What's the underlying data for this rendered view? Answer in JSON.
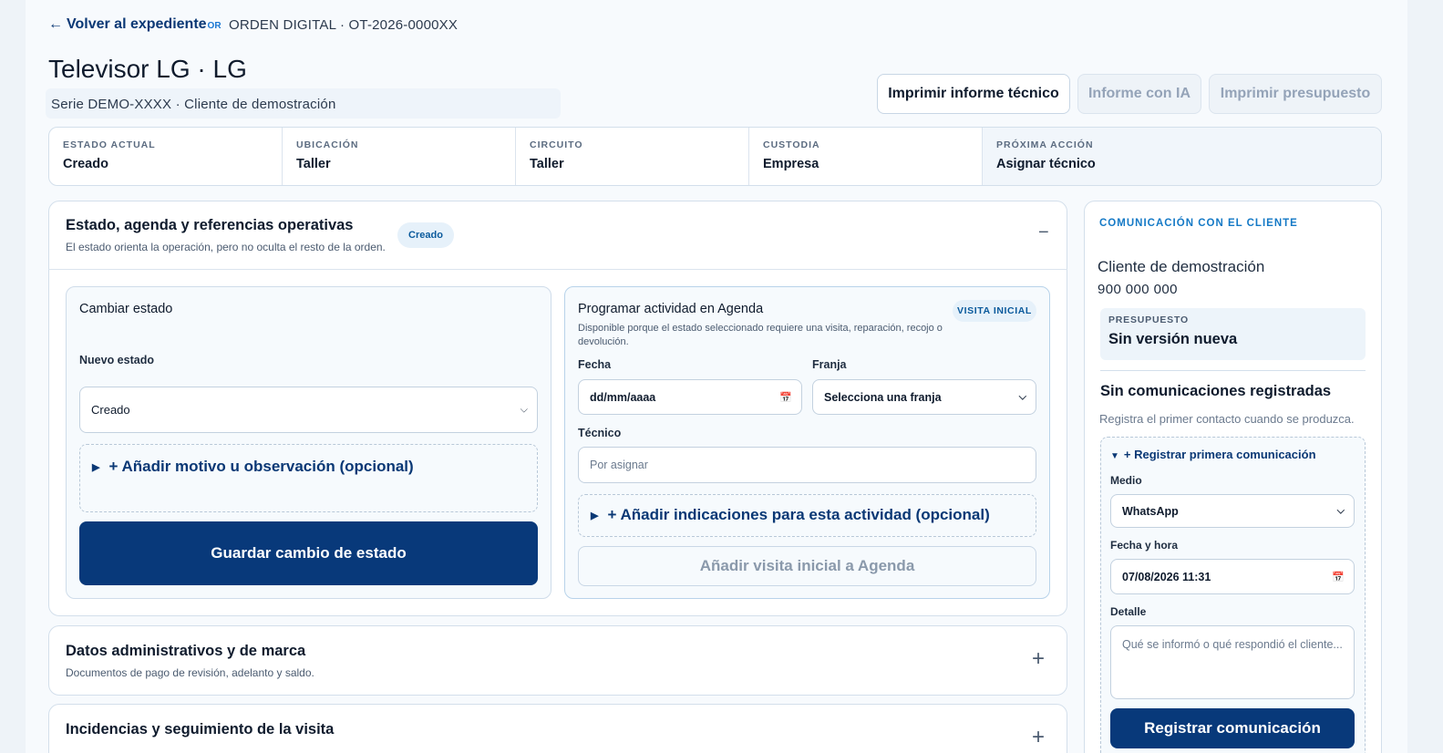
{
  "header": {
    "back_arrow": "←",
    "back_label": "Volver al expediente",
    "back_badge": "OR",
    "order_code": "ORDEN DIGITAL · OT-2026-0000XX",
    "title": "Televisor LG · LG",
    "subtitle": "Serie DEMO-XXXX · Cliente de demostración"
  },
  "actions": {
    "print_report": "Imprimir informe técnico",
    "ai_report": "Informe con IA",
    "print_budget": "Imprimir presupuesto"
  },
  "status_strip": [
    {
      "label": "Estado actual",
      "value": "Creado"
    },
    {
      "label": "Ubicación",
      "value": "Taller"
    },
    {
      "label": "Circuito",
      "value": "Taller"
    },
    {
      "label": "Custodia",
      "value": "Empresa"
    },
    {
      "label": "Próxima acción",
      "value": "Asignar técnico"
    }
  ],
  "status_section": {
    "title": "Estado, agenda y referencias operativas",
    "description": "El estado orienta la operación, pero no oculta el resto de la orden.",
    "badge": "Creado",
    "collapse_symbol": "−",
    "change_state": {
      "title": "Cambiar estado",
      "new_state_label": "Nuevo estado",
      "new_state_value": "Creado",
      "add_reason": "+ Añadir motivo u observación (opcional)",
      "save_button": "Guardar cambio de estado"
    },
    "agenda": {
      "title": "Programar actividad en Agenda",
      "badge": "VISITA INICIAL",
      "description": "Disponible porque el estado seleccionado requiere una visita, reparación, recojo o devolución.",
      "date_label": "Fecha",
      "date_placeholder": "dd/mm/aaaa",
      "slot_label": "Franja",
      "slot_value": "Selecciona una franja",
      "tech_label": "Técnico",
      "tech_placeholder": "Por asignar",
      "add_notes": "+ Añadir indicaciones para esta actividad (opcional)",
      "add_button": "Añadir visita inicial a Agenda"
    }
  },
  "admin_section": {
    "title": "Datos administrativos y de marca",
    "description": "Documentos de pago de revisión, adelanto y saldo.",
    "expand_symbol": "+"
  },
  "incidents_section": {
    "title": "Incidencias y seguimiento de la visita",
    "expand_symbol": "+"
  },
  "communication": {
    "title": "COMUNICACIÓN CON EL CLIENTE",
    "client_name": "Cliente de demostración",
    "client_phone": "900 000 000",
    "budget_label": "PRESUPUESTO",
    "budget_value": "Sin versión nueva",
    "empty_title": "Sin comunicaciones registradas",
    "empty_desc": "Registra el primer contacto cuando se produzca.",
    "register_summary": "+ Registrar primera comunicación",
    "medium_label": "Medio",
    "medium_value": "WhatsApp",
    "datetime_label": "Fecha y hora",
    "datetime_value": "07/08/2026 11:31",
    "detail_label": "Detalle",
    "detail_placeholder": "Qué se informó o qué respondió el cliente...",
    "register_button": "Registrar comunicación"
  },
  "colors": {
    "primary": "#08397a",
    "accent": "#1479c6",
    "background": "#f7fafd"
  }
}
